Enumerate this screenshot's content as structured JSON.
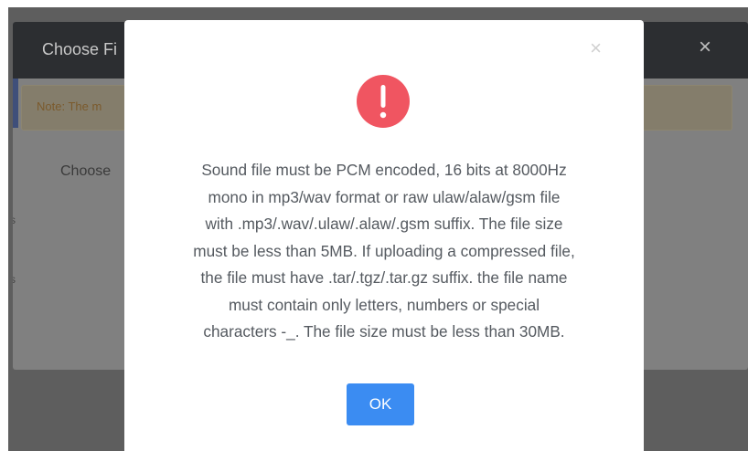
{
  "background_dialog": {
    "title": "Choose Fi",
    "close_glyph": "×",
    "note_text": "Note: The m",
    "label": "Choose",
    "edge_marks": [
      "s",
      "s"
    ]
  },
  "alert": {
    "close_glyph": "×",
    "icon": "exclamation-circle-icon",
    "icon_color": "#f05561",
    "message_lines": [
      "Sound file must be PCM encoded, 16 bits at 8000Hz",
      "mono in mp3/wav format or raw ulaw/alaw/gsm file",
      "with .mp3/.wav/.ulaw/.alaw/.gsm suffix. The file size",
      "must be less than 5MB. If uploading a compressed file,",
      "the file must have .tar/.tgz/.tar.gz suffix. the file name",
      "must contain only letters, numbers or special",
      "characters -_. The file size must be less than 30MB."
    ],
    "ok_label": "OK",
    "ok_color": "#3b8cf2"
  }
}
